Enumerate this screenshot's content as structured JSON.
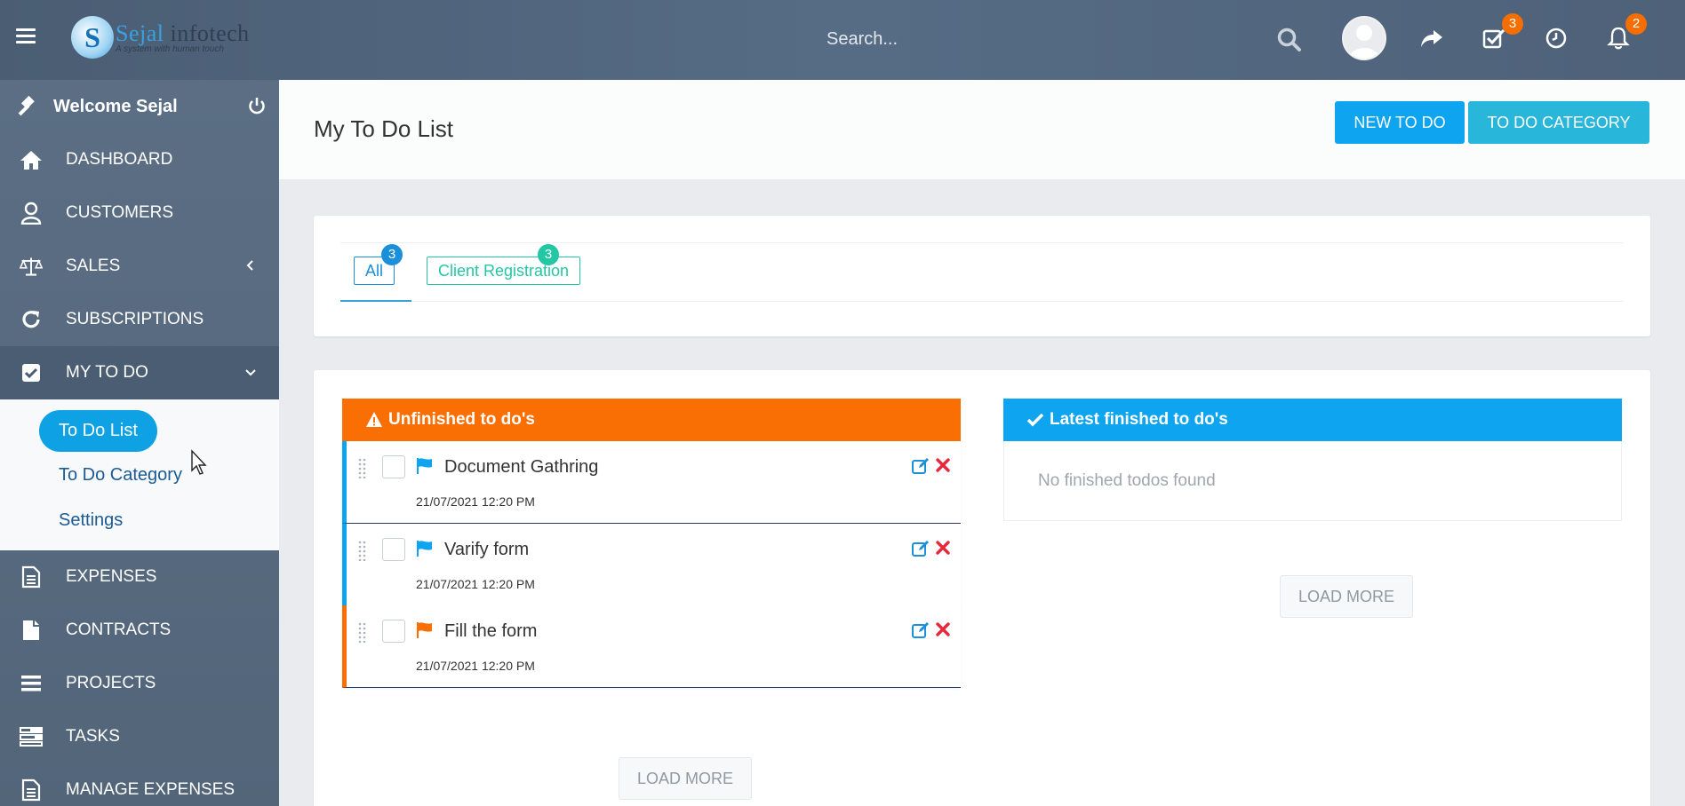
{
  "topbar": {
    "logo_letter": "S",
    "logo_name_first": "Sejal",
    "logo_name_second": " infotech",
    "logo_tagline": "A system with human touch",
    "search_placeholder": "Search...",
    "tasks_badge": "3",
    "notifications_badge": "2"
  },
  "sidebar": {
    "welcome": "Welcome Sejal",
    "items": [
      {
        "label": "DASHBOARD",
        "icon": "home-icon"
      },
      {
        "label": "CUSTOMERS",
        "icon": "user-icon"
      },
      {
        "label": "SALES",
        "icon": "balance-scale-icon"
      },
      {
        "label": "SUBSCRIPTIONS",
        "icon": "refresh-icon"
      },
      {
        "label": "MY TO DO",
        "icon": "check-square-icon"
      },
      {
        "label": "EXPENSES",
        "icon": "file-text-icon"
      },
      {
        "label": "CONTRACTS",
        "icon": "file-icon"
      },
      {
        "label": "PROJECTS",
        "icon": "bars-icon"
      },
      {
        "label": "TASKS",
        "icon": "tasks-icon"
      },
      {
        "label": "MANAGE EXPENSES",
        "icon": "file-text-icon"
      }
    ],
    "submenu": [
      "To Do List",
      "To Do Category",
      "Settings"
    ]
  },
  "header": {
    "title": "My To Do List",
    "new_todo": "NEW TO DO",
    "todo_category": "TO DO CATEGORY"
  },
  "filters": [
    {
      "label": "All",
      "count": "3",
      "color": "#1b8fd9"
    },
    {
      "label": "Client Registration",
      "count": "3",
      "color": "#24c7a3"
    }
  ],
  "unfinished": {
    "title": "Unfinished to do's",
    "load_more": "LOAD MORE",
    "items": [
      {
        "name": "Document Gathring",
        "date": "21/07/2021 12:20 PM",
        "flag_color": "#0ea4ef"
      },
      {
        "name": "Varify form",
        "date": "21/07/2021 12:20 PM",
        "flag_color": "#0ea4ef"
      },
      {
        "name": "Fill the form",
        "date": "21/07/2021 12:20 PM",
        "flag_color": "#fa6f03"
      }
    ]
  },
  "finished": {
    "title": "Latest finished to do's",
    "empty": "No finished todos found",
    "load_more": "LOAD MORE"
  },
  "colors": {
    "accent": "#0ea4ef",
    "warning": "#fa6f03",
    "success": "#24c7a3",
    "danger": "#e8273b"
  }
}
